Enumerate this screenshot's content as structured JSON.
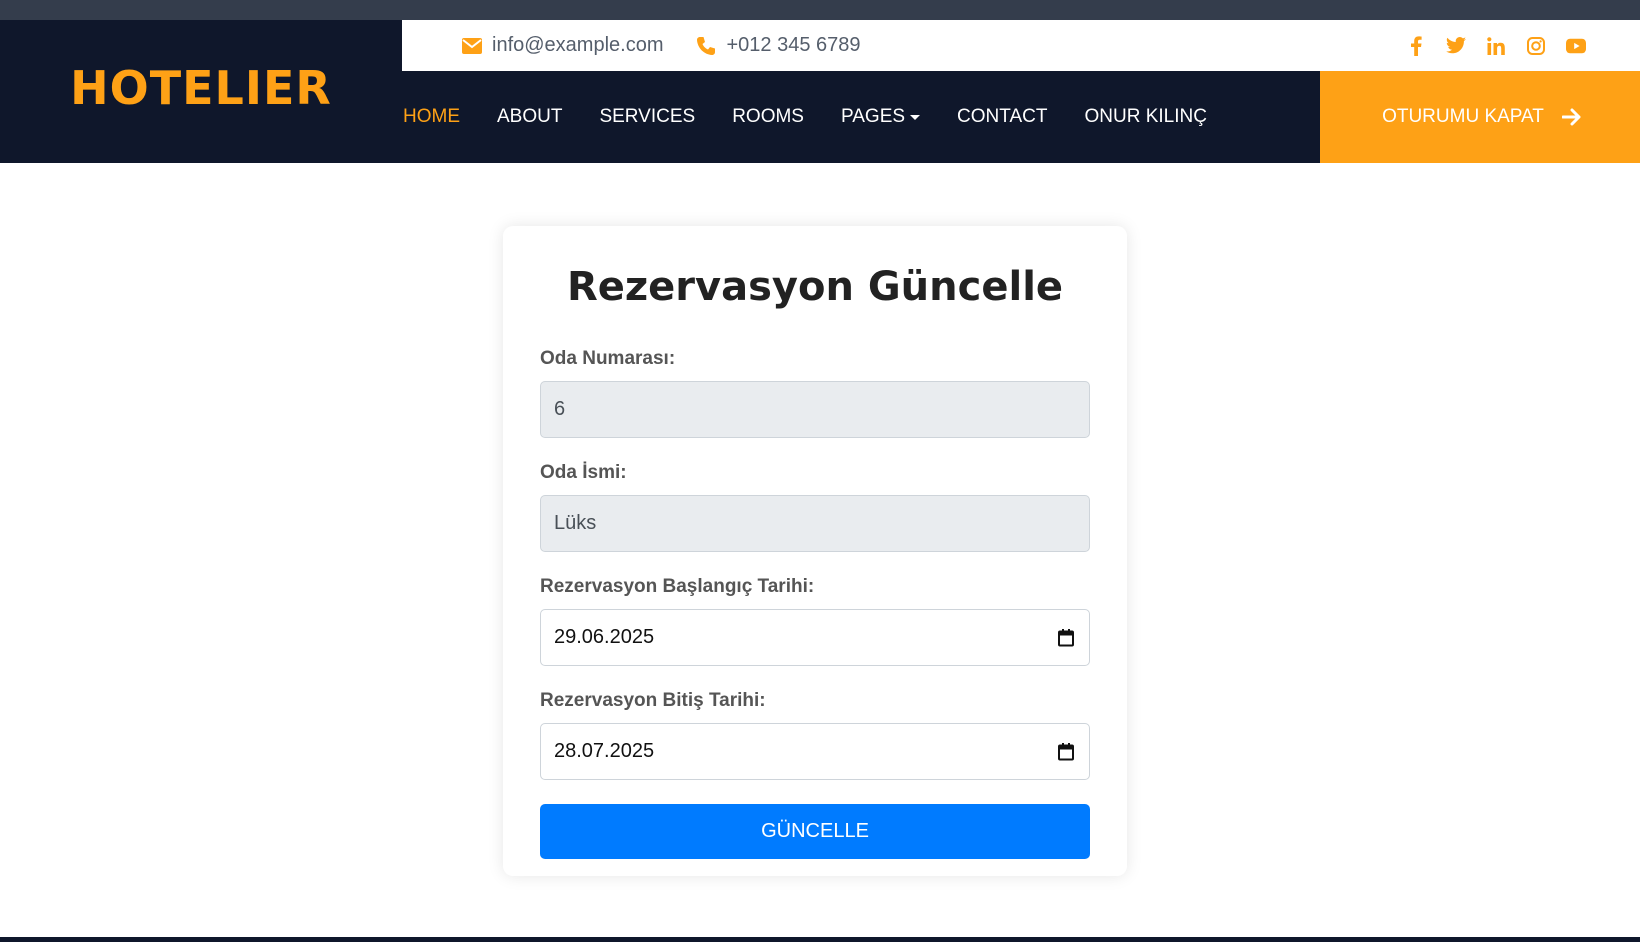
{
  "brand": {
    "name": "HOTELIER",
    "accent": "#fea116",
    "dark": "#0f172b"
  },
  "topbar": {
    "email": "info@example.com",
    "phone": "+012 345 6789",
    "socials": [
      "facebook-icon",
      "twitter-icon",
      "linkedin-icon",
      "instagram-icon",
      "youtube-icon"
    ]
  },
  "nav": {
    "items": [
      {
        "label": "HOME",
        "active": true
      },
      {
        "label": "ABOUT"
      },
      {
        "label": "SERVICES"
      },
      {
        "label": "ROOMS"
      },
      {
        "label": "PAGES",
        "dropdown": true
      },
      {
        "label": "CONTACT"
      },
      {
        "label": "ONUR KILINÇ"
      }
    ],
    "logout_label": "OTURUMU KAPAT"
  },
  "form": {
    "title": "Rezervasyon Güncelle",
    "room_number_label": "Oda Numarası:",
    "room_number_value": "6",
    "room_name_label": "Oda İsmi:",
    "room_name_value": "Lüks",
    "start_date_label": "Rezervasyon Başlangıç Tarihi:",
    "start_date_value": "29.06.2025",
    "end_date_label": "Rezervasyon Bitiş Tarihi:",
    "end_date_value": "28.07.2025",
    "submit_label": "GÜNCELLE",
    "submit_color": "#007bff"
  }
}
